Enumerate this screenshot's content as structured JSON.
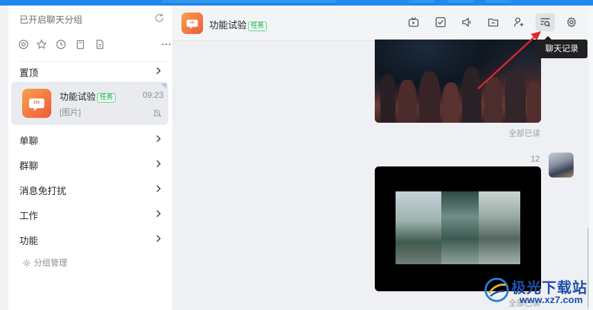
{
  "sidebar": {
    "header": "已开启聊天分组",
    "groups": [
      {
        "label": "置顶"
      },
      {
        "label": "单聊"
      },
      {
        "label": "群聊"
      },
      {
        "label": "消息免打扰"
      },
      {
        "label": "工作"
      },
      {
        "label": "功能"
      }
    ],
    "conversation": {
      "name": "功能试验",
      "tag": "任务",
      "time": "09:23",
      "preview": "[图片]"
    },
    "manage_label": "分组管理"
  },
  "chat": {
    "title": "功能试验",
    "tag": "任务",
    "tooltip": "聊天记录",
    "read_status_1": "全部已读",
    "message_time": "12",
    "read_status_2": "全部已读"
  },
  "watermark": {
    "text": "极光下载站",
    "url": "www.xz7.com"
  },
  "colors": {
    "accent": "#1e88ee",
    "tag_green": "#17a34a",
    "arrow_red": "#e0262a",
    "avatar_orange": "#f08a3e"
  }
}
